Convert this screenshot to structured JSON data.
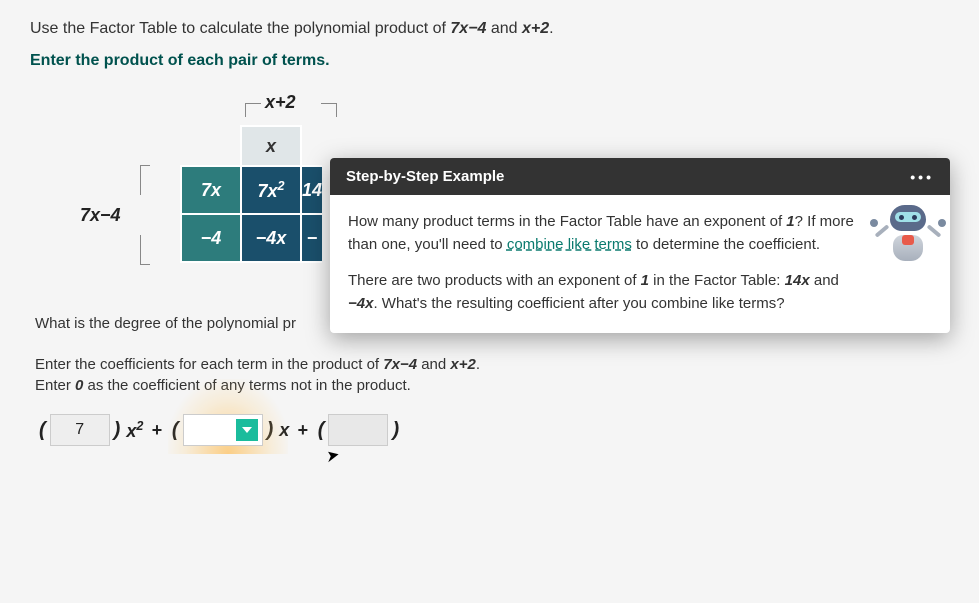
{
  "instructions": {
    "main_prefix": "Use the Factor Table to calculate the polynomial product of ",
    "main_expr1": "7x−4",
    "main_mid": " and ",
    "main_expr2": "x+2",
    "main_suffix": ".",
    "bold": "Enter the product of each pair of terms."
  },
  "table": {
    "top_label": "x+2",
    "left_label": "7x−4",
    "col_headers": [
      "x"
    ],
    "row_headers": [
      "7x",
      "−4"
    ],
    "cells": {
      "r0c0": "7x²",
      "r0c1": "14",
      "r1c0": "−4x",
      "r1c1": "−"
    }
  },
  "degree_question": "What is the degree of the polynomial pr",
  "coeff": {
    "line1_prefix": "Enter the coefficients for each term in the product of ",
    "line1_e1": "7x−4",
    "line1_mid": " and ",
    "line1_e2": "x+2",
    "line1_suffix": ".",
    "line2_prefix": "Enter ",
    "line2_zero": "0",
    "line2_suffix": " as the coefficient of any terms not in the product."
  },
  "answer": {
    "box1": "7",
    "term1": "x²",
    "plus": "+",
    "dropdown_value": "",
    "term2": "x",
    "box3": ""
  },
  "tooltip": {
    "title": "Step-by-Step Example",
    "p1_a": "How many product terms in the Factor Table have an exponent of ",
    "p1_one": "1",
    "p1_b": "? If more than one, you'll need to ",
    "p1_link": "combine like terms",
    "p1_c": " to determine the coefficient.",
    "p2_a": "There are two products with an exponent of ",
    "p2_one": "1",
    "p2_b": " in the Factor Table: ",
    "p2_t1": "14x",
    "p2_and": " and ",
    "p2_t2": "−4x",
    "p2_c": ". What's the resulting coefficient after you combine like terms?"
  }
}
